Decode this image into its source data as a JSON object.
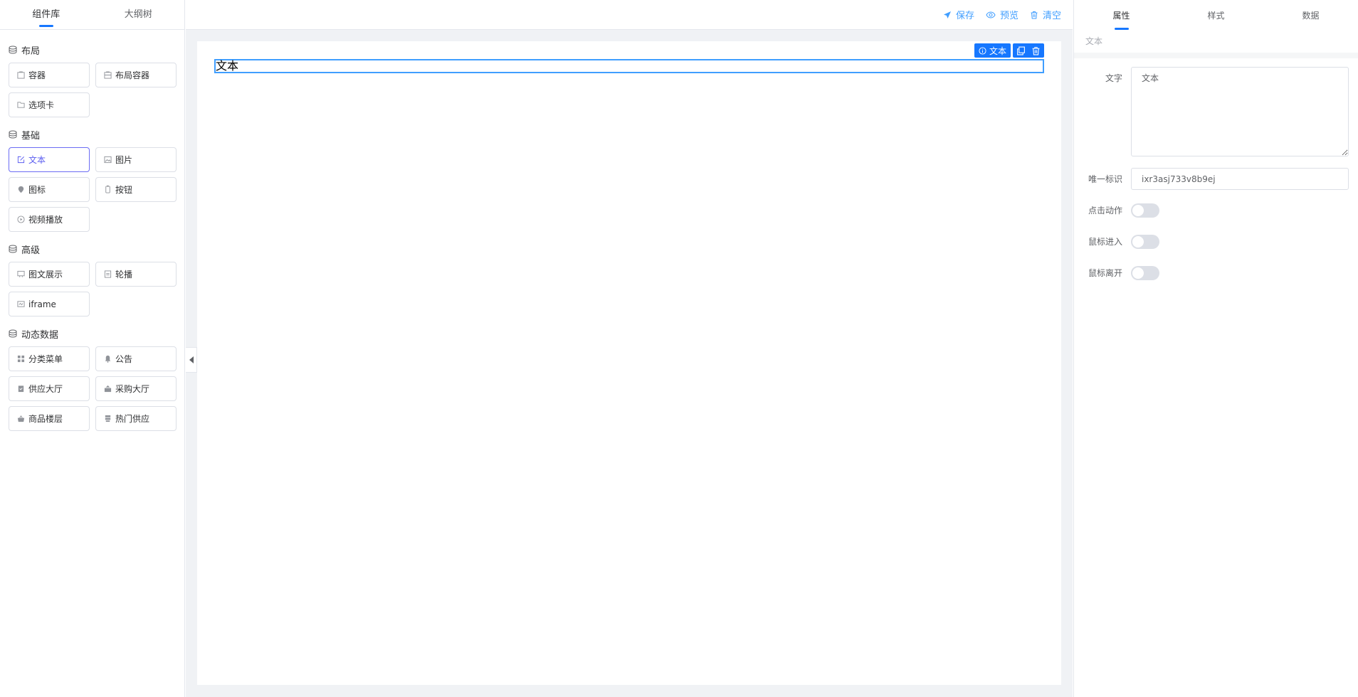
{
  "left_tabs": [
    "组件库",
    "大纲树"
  ],
  "groups": [
    {
      "title": "布局",
      "items": [
        {
          "label": "容器",
          "icon": "container-icon"
        },
        {
          "label": "布局容器",
          "icon": "layout-container-icon"
        },
        {
          "label": "选项卡",
          "icon": "folder-icon"
        }
      ]
    },
    {
      "title": "基础",
      "items": [
        {
          "label": "文本",
          "icon": "edit-icon"
        },
        {
          "label": "图片",
          "icon": "image-icon"
        },
        {
          "label": "图标",
          "icon": "icon-icon"
        },
        {
          "label": "按钮",
          "icon": "button-icon"
        },
        {
          "label": "视频播放",
          "icon": "play-icon"
        }
      ]
    },
    {
      "title": "高级",
      "items": [
        {
          "label": "图文展示",
          "icon": "picture-text-icon"
        },
        {
          "label": "轮播",
          "icon": "carousel-icon"
        },
        {
          "label": "iframe",
          "icon": "iframe-icon"
        }
      ]
    },
    {
      "title": "动态数据",
      "items": [
        {
          "label": "分类菜单",
          "icon": "grid-icon"
        },
        {
          "label": "公告",
          "icon": "bell-icon"
        },
        {
          "label": "供应大厅",
          "icon": "clipboard-icon"
        },
        {
          "label": "采购大厅",
          "icon": "shop-icon"
        },
        {
          "label": "商品楼层",
          "icon": "basket-icon"
        },
        {
          "label": "热门供应",
          "icon": "stack-icon"
        }
      ]
    }
  ],
  "toolbar": {
    "save": "保存",
    "preview": "预览",
    "clear": "清空"
  },
  "canvas": {
    "text": "文本",
    "tag": "文本"
  },
  "right_tabs": [
    "属性",
    "样式",
    "数据"
  ],
  "breadcrumb": "文本",
  "props": {
    "text_label": "文字",
    "text_value": "文本",
    "id_label": "唯一标识",
    "id_value": "ixr3asj733v8b9ej",
    "click_label": "点击动作",
    "enter_label": "鼠标进入",
    "leave_label": "鼠标离开"
  },
  "colors": {
    "accent": "#1677ff",
    "link": "#409eff",
    "active_border": "#6b6cf4"
  }
}
